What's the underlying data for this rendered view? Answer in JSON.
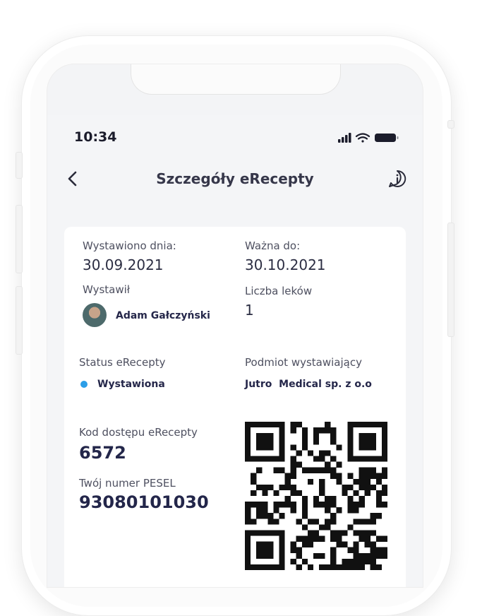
{
  "status_bar": {
    "time": "10:34"
  },
  "header": {
    "title": "Szczegóły eRecepty"
  },
  "details": {
    "issued_label": "Wystawiono dnia:",
    "issued_value": "30.09.2021",
    "valid_label": "Ważna do:",
    "valid_value": "30.10.2021",
    "issuer_label": "Wystawił",
    "issuer_name": "Adam Gałczyński",
    "drug_count_label": "Liczba leków",
    "drug_count_value": "1",
    "status_label": "Status eRecepty",
    "status_value": "Wystawiona",
    "entity_label": "Podmiot wystawiający",
    "entity_value": "Jutro  Medical sp. z o.o",
    "code_label": "Kod dostępu eRecepty",
    "code_value": "6572",
    "pesel_label": "Twój numer PESEL",
    "pesel_value": "93080101030"
  },
  "colors": {
    "status_dot": "#2b9ee8",
    "text_dark": "#23264a",
    "card_bg": "#ffffff",
    "screen_bg": "#f4f5f7"
  },
  "icons": {
    "back": "chevron-left-icon",
    "info": "info-icon",
    "signal": "signal-icon",
    "wifi": "wifi-icon",
    "battery": "battery-icon"
  }
}
